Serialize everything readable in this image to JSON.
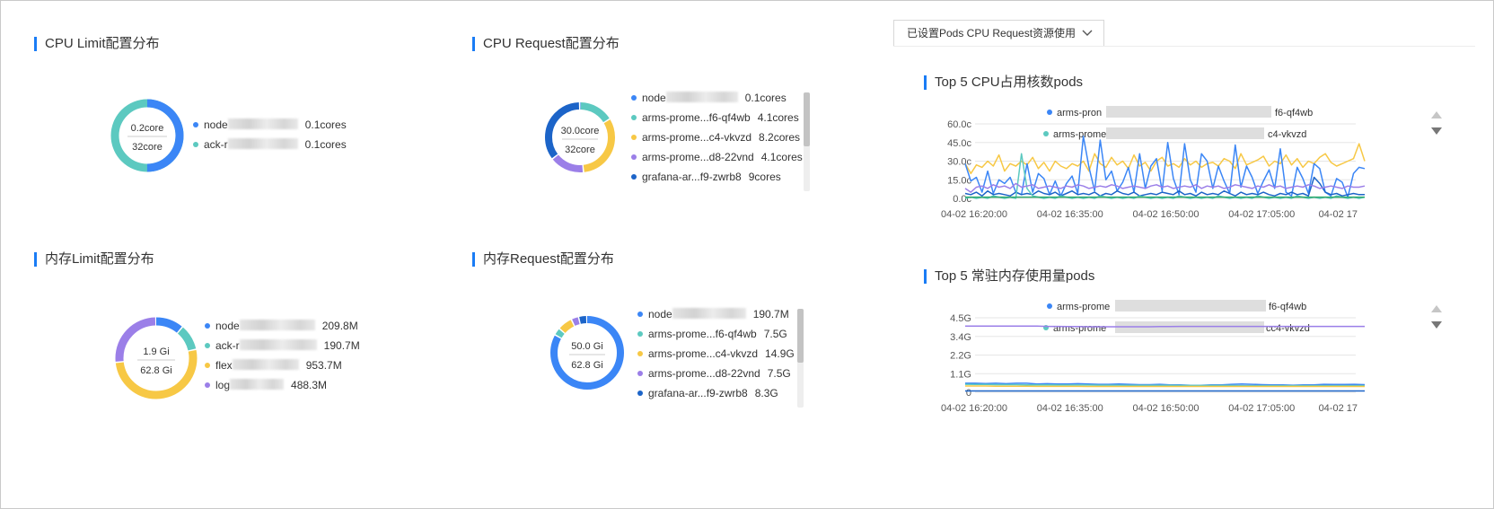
{
  "cards": {
    "cpu_limit": {
      "title": "CPU Limit配置分布",
      "center_top": "0.2core",
      "center_bottom": "32core",
      "legend": [
        {
          "prefix": "node",
          "value": "0.1cores",
          "color": "#3b86f6"
        },
        {
          "prefix": "ack-r",
          "value": "0.1cores",
          "color": "#5cc9c0"
        }
      ]
    },
    "cpu_request": {
      "title": "CPU Request配置分布",
      "center_top": "30.0core",
      "center_bottom": "32core",
      "legend": [
        {
          "prefix": "node",
          "value": "0.1cores",
          "color": "#3b86f6"
        },
        {
          "prefix": "arms-prome...f6-qf4wb",
          "value": "4.1cores",
          "color": "#5cc9c0"
        },
        {
          "prefix": "arms-prome...c4-vkvzd",
          "value": "8.2cores",
          "color": "#f7c845"
        },
        {
          "prefix": "arms-prome...d8-22vnd",
          "value": "4.1cores",
          "color": "#9b7fe8"
        },
        {
          "prefix": "grafana-ar...f9-zwrb8",
          "value": "9cores",
          "color": "#1c64c8"
        }
      ]
    },
    "mem_limit": {
      "title": "内存Limit配置分布",
      "center_top": "1.9 Gi",
      "center_bottom": "62.8 Gi",
      "legend": [
        {
          "prefix": "node",
          "value": "209.8M",
          "color": "#3b86f6"
        },
        {
          "prefix": "ack-r",
          "value": "190.7M",
          "color": "#5cc9c0"
        },
        {
          "prefix": "flex",
          "value": "953.7M",
          "color": "#f7c845"
        },
        {
          "prefix": "log",
          "value": "488.3M",
          "color": "#9b7fe8"
        }
      ]
    },
    "mem_request": {
      "title": "内存Request配置分布",
      "center_top": "50.0 Gi",
      "center_bottom": "62.8 Gi",
      "legend": [
        {
          "prefix": "node",
          "value": "190.7M",
          "color": "#3b86f6"
        },
        {
          "prefix": "arms-prome...f6-qf4wb",
          "value": "7.5G",
          "color": "#5cc9c0"
        },
        {
          "prefix": "arms-prome...c4-vkvzd",
          "value": "14.9G",
          "color": "#f7c845"
        },
        {
          "prefix": "arms-prome...d8-22vnd",
          "value": "7.5G",
          "color": "#9b7fe8"
        },
        {
          "prefix": "grafana-ar...f9-zwrb8",
          "value": "8.3G",
          "color": "#1c64c8"
        }
      ]
    }
  },
  "dropdown": {
    "label": "已设置Pods CPU Request资源使用"
  },
  "chart_data": [
    {
      "type": "line",
      "title": "Top 5 CPU占用核数pods",
      "legend_visible": [
        {
          "name_prefix": "arms-pron",
          "name_suffix": "f6-qf4wb",
          "color": "#3b86f6"
        },
        {
          "name_prefix": "arms-prome",
          "name_suffix": "c4-vkvzd",
          "color": "#5cc9c0"
        }
      ],
      "y_ticks": [
        "60.0c",
        "45.0c",
        "30.0c",
        "15.0c",
        "0.0c"
      ],
      "ylim": [
        0,
        60
      ],
      "x_ticks": [
        "04-02 16:20:00",
        "04-02 16:35:00",
        "04-02 16:50:00",
        "04-02 17:05:00",
        "04-02 17"
      ],
      "series": [
        {
          "color": "#f7c845",
          "values": [
            28,
            20,
            27,
            25,
            30,
            26,
            35,
            22,
            28,
            26,
            30,
            27,
            33,
            24,
            29,
            22,
            30,
            26,
            24,
            28,
            26,
            30,
            22,
            36,
            28,
            25,
            33,
            27,
            30,
            24,
            35,
            26,
            29,
            22,
            30,
            33,
            26,
            28,
            25,
            32,
            27,
            30,
            25,
            28,
            29,
            26,
            32,
            30,
            24,
            36,
            27,
            29,
            31,
            34,
            26,
            30,
            28,
            35,
            27,
            32,
            25,
            30,
            28,
            33,
            36,
            29,
            26,
            28,
            30,
            32,
            44,
            30
          ]
        },
        {
          "color": "#3b86f6",
          "values": [
            28,
            14,
            17,
            5,
            22,
            4,
            15,
            12,
            17,
            5,
            3,
            28,
            5,
            20,
            16,
            3,
            14,
            2,
            12,
            18,
            4,
            50,
            25,
            6,
            47,
            15,
            22,
            6,
            13,
            25,
            5,
            36,
            8,
            26,
            32,
            6,
            45,
            16,
            3,
            44,
            15,
            5,
            36,
            30,
            8,
            26,
            14,
            4,
            43,
            9,
            26,
            17,
            4,
            14,
            23,
            8,
            40,
            5,
            2,
            25,
            16,
            4,
            28,
            24,
            5,
            2,
            16,
            13,
            1,
            20,
            25,
            24
          ]
        },
        {
          "color": "#1c64c8",
          "values": [
            4,
            3,
            5,
            2,
            6,
            3,
            4,
            3,
            2,
            5,
            3,
            4,
            3,
            6,
            4,
            3,
            5,
            2,
            4,
            6,
            3,
            4,
            3,
            5,
            2,
            4,
            3,
            6,
            4,
            3,
            5,
            2,
            3,
            4,
            3,
            5,
            4,
            3,
            6,
            3,
            4,
            2,
            5,
            3,
            4,
            3,
            6,
            4,
            2,
            5,
            3,
            4,
            3,
            5,
            3,
            2,
            4,
            3,
            5,
            3,
            4,
            2,
            17,
            12,
            5,
            3,
            4,
            2,
            3,
            4,
            3,
            3
          ]
        },
        {
          "color": "#5cc9c0",
          "values": [
            0,
            1,
            0,
            1,
            0,
            2,
            1,
            0,
            1,
            0,
            36,
            8,
            2,
            1,
            0,
            1,
            0,
            2,
            1,
            0,
            1,
            0,
            1,
            0,
            2,
            1,
            0,
            1,
            0,
            1,
            0,
            2,
            1,
            0,
            1,
            0,
            1,
            0,
            2,
            1,
            0,
            1,
            0,
            1,
            0,
            2,
            1,
            0,
            1,
            0,
            1,
            0,
            2,
            1,
            0,
            1,
            0,
            1,
            0,
            2,
            1,
            0,
            1,
            0,
            1,
            0,
            2,
            1,
            0,
            1,
            0,
            1
          ]
        },
        {
          "color": "#9b7fe8",
          "values": [
            8,
            5,
            9,
            10,
            8,
            11,
            9,
            10,
            8,
            12,
            9,
            10,
            11,
            8,
            9,
            10,
            9,
            8,
            10,
            9,
            11,
            10,
            8,
            9,
            10,
            9,
            11,
            10,
            8,
            9,
            10,
            9,
            8,
            10,
            11,
            9,
            10,
            8,
            9,
            10,
            9,
            11,
            8,
            10,
            9,
            10,
            8,
            9,
            11,
            10,
            9,
            8,
            10,
            9,
            11,
            9,
            10,
            8,
            9,
            10,
            9,
            11,
            10,
            8,
            9,
            10,
            9,
            8,
            10,
            9,
            9,
            10
          ]
        },
        {
          "color": "#2ea86b",
          "values": [
            1,
            1,
            1,
            1,
            1,
            1,
            1,
            1,
            1,
            1,
            1,
            1,
            1,
            1,
            1,
            1,
            1,
            1,
            1,
            1,
            1,
            1,
            1,
            1,
            1,
            1,
            1,
            1,
            1,
            1,
            1,
            1,
            1,
            1,
            1,
            1,
            1,
            1,
            1,
            1,
            1,
            1,
            1,
            1,
            1,
            1,
            1,
            1,
            1,
            1,
            1,
            1,
            1,
            1,
            1,
            1,
            1,
            1,
            1,
            1,
            1,
            1,
            1,
            1,
            1,
            1,
            1,
            1,
            1,
            1,
            1,
            1
          ]
        }
      ]
    },
    {
      "type": "line",
      "title": "Top 5 常驻内存使用量pods",
      "legend_visible": [
        {
          "name_prefix": "arms-prome",
          "name_suffix": "f6-qf4wb",
          "color": "#3b86f6"
        },
        {
          "name_prefix": "arms-prome",
          "name_suffix": "cc4-vkvzd",
          "color": "#5cc9c0"
        }
      ],
      "y_ticks": [
        "4.5G",
        "3.4G",
        "2.2G",
        "1.1G",
        "0"
      ],
      "ylim": [
        0,
        4.5
      ],
      "x_ticks": [
        "04-02 16:20:00",
        "04-02 16:35:00",
        "04-02 16:50:00",
        "04-02 17:05:00",
        "04-02 17"
      ],
      "series": [
        {
          "color": "#9b7fe8",
          "values": [
            4.0,
            4.0,
            4.0,
            4.0,
            4.0,
            4.0,
            4.0,
            4.0,
            3.98,
            3.98,
            3.97,
            3.97,
            3.96,
            3.96,
            3.96,
            3.96,
            3.96,
            3.96,
            3.96,
            3.97,
            3.97,
            3.98,
            3.98,
            3.98,
            3.98,
            3.98,
            3.98,
            3.98,
            3.98,
            3.98,
            3.98,
            3.98,
            3.98,
            3.98,
            3.98,
            3.98,
            3.98,
            3.98,
            3.98,
            3.98
          ]
        },
        {
          "color": "#3b86f6",
          "values": [
            0.55,
            0.55,
            0.53,
            0.55,
            0.52,
            0.55,
            0.55,
            0.5,
            0.52,
            0.5,
            0.5,
            0.52,
            0.5,
            0.48,
            0.48,
            0.5,
            0.48,
            0.46,
            0.46,
            0.48,
            0.45,
            0.45,
            0.42,
            0.42,
            0.45,
            0.45,
            0.48,
            0.5,
            0.48,
            0.46,
            0.45,
            0.45,
            0.43,
            0.45,
            0.45,
            0.48,
            0.47,
            0.47,
            0.48,
            0.46
          ]
        },
        {
          "color": "#5cc9c0",
          "values": [
            0.48,
            0.47,
            0.47,
            0.46,
            0.46,
            0.46,
            0.45,
            0.45,
            0.45,
            0.44,
            0.44,
            0.44,
            0.44,
            0.43,
            0.43,
            0.43,
            0.42,
            0.42,
            0.42,
            0.42,
            0.42,
            0.41,
            0.41,
            0.41,
            0.41,
            0.41,
            0.41,
            0.4,
            0.4,
            0.4,
            0.4,
            0.4,
            0.4,
            0.4,
            0.4,
            0.4,
            0.4,
            0.4,
            0.4,
            0.4
          ]
        },
        {
          "color": "#f7c845",
          "values": [
            0.38,
            0.38,
            0.38,
            0.37,
            0.37,
            0.37,
            0.37,
            0.36,
            0.36,
            0.36,
            0.36,
            0.36,
            0.35,
            0.35,
            0.35,
            0.35,
            0.35,
            0.35,
            0.35,
            0.35,
            0.35,
            0.35,
            0.35,
            0.35,
            0.35,
            0.35,
            0.35,
            0.35,
            0.35,
            0.35,
            0.35,
            0.35,
            0.35,
            0.35,
            0.35,
            0.35,
            0.35,
            0.35,
            0.35,
            0.35
          ]
        },
        {
          "color": "#1c64c8",
          "values": [
            0.08,
            0.08,
            0.08,
            0.08,
            0.08,
            0.08,
            0.08,
            0.08,
            0.08,
            0.08,
            0.08,
            0.08,
            0.08,
            0.08,
            0.08,
            0.08,
            0.08,
            0.08,
            0.08,
            0.08,
            0.08,
            0.08,
            0.08,
            0.08,
            0.08,
            0.08,
            0.08,
            0.08,
            0.08,
            0.08,
            0.08,
            0.08,
            0.08,
            0.08,
            0.08,
            0.08,
            0.08,
            0.08,
            0.08,
            0.08
          ]
        }
      ]
    }
  ]
}
